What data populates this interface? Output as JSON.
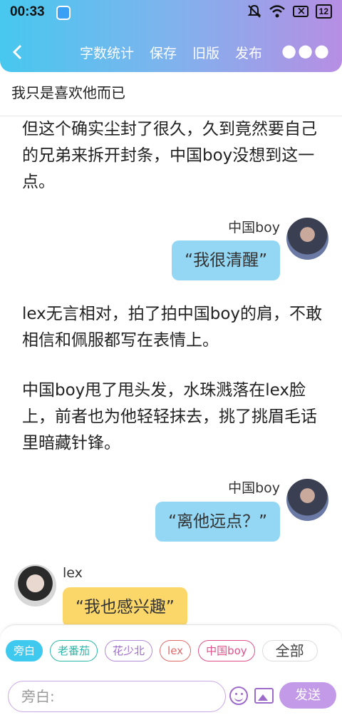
{
  "status_bar": {
    "time": "00:33",
    "battery": "12"
  },
  "toolbar": {
    "back_icon": "chevron-left-icon",
    "actions": [
      "字数统计",
      "保存",
      "旧版",
      "发布"
    ],
    "more_icon": "more-dots-icon"
  },
  "page_title": "我只是喜欢他而已",
  "story": {
    "para1": "但这个确实尘封了很久，久到竟然要自己的兄弟来拆开封条，中国boy没想到这一点。",
    "msg1": {
      "speaker": "中国boy",
      "text": "“我很清醒”"
    },
    "para2": "lex无言相对，拍了拍中国boy的肩，不敢相信和佩服都写在表情上。",
    "para3": "中国boy甩了甩头发，水珠溅落在lex脸上，前者也为他轻轻抹去，挑了挑眉毛话里暗藏针锋。",
    "msg2": {
      "speaker": "中国boy",
      "text": "“离他远点？”"
    },
    "msg3": {
      "speaker": "lex",
      "text": "“我也感兴趣”"
    }
  },
  "composer": {
    "chips": [
      "旁白",
      "老番茄",
      "花少北",
      "lex",
      "中国boy",
      "全部"
    ],
    "placeholder": "旁白:",
    "send_label": "发送"
  },
  "colors": {
    "header_gradient_start": "#47c8ee",
    "header_gradient_end": "#b78ee3",
    "bubble_blue": "#93d7f4",
    "bubble_yellow": "#fbd76a",
    "accent_purple": "#c39ae8"
  }
}
